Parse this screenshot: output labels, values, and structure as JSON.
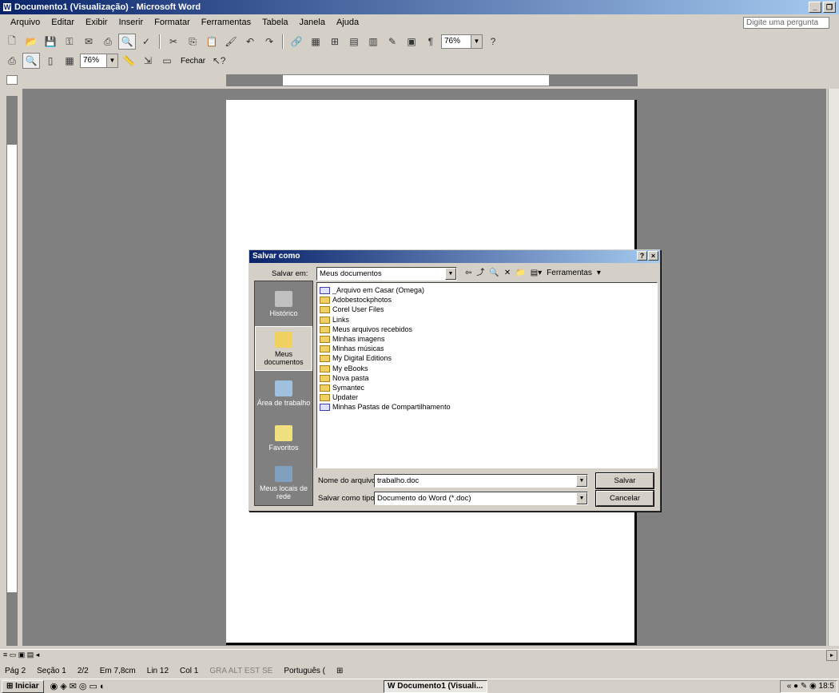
{
  "window": {
    "title": "Documento1 (Visualização) - Microsoft Word"
  },
  "menubar": {
    "items": [
      "Arquivo",
      "Editar",
      "Exibir",
      "Inserir",
      "Formatar",
      "Ferramentas",
      "Tabela",
      "Janela",
      "Ajuda"
    ],
    "help_placeholder": "Digite uma pergunta"
  },
  "toolbar1": {
    "zoom": "76%",
    "zoom_small": "▾"
  },
  "toolbar2": {
    "zoom": "76%",
    "close_label": "Fechar"
  },
  "dialog": {
    "title": "Salvar como",
    "save_in_label": "Salvar em:",
    "save_in_value": "Meus documentos",
    "tools_label": "Ferramentas",
    "places": [
      {
        "label": "Histórico"
      },
      {
        "label": "Meus documentos"
      },
      {
        "label": "Área de trabalho"
      },
      {
        "label": "Favoritos"
      },
      {
        "label": "Meus locais de rede"
      }
    ],
    "files": [
      "_Arquivo em Casar (Omega)",
      "Adobestockphotos",
      "Corel User Files",
      "Links",
      "Meus arquivos recebidos",
      "Minhas imagens",
      "Minhas músicas",
      "My Digital Editions",
      "My eBooks",
      "Nova pasta",
      "Symantec",
      "Updater",
      "Minhas Pastas de Compartilhamento"
    ],
    "filename_label": "Nome do arquivo:",
    "filename_value": "trabalho.doc",
    "filetype_label": "Salvar como tipo:",
    "filetype_value": "Documento do Word (*.doc)",
    "save_button": "Salvar",
    "cancel_button": "Cancelar"
  },
  "status": {
    "page": "Pág 2",
    "section": "Seção 1",
    "pages": "2/2",
    "position": "Em 7,8cm",
    "line": "Lin 12",
    "column": "Col 1",
    "modes": "GRA ALT EST SE",
    "language": "Português (",
    "icon": "⊞"
  },
  "taskbar": {
    "start": "Iniciar",
    "task": "Documento1 (Visuali...",
    "clock": "18:5"
  }
}
